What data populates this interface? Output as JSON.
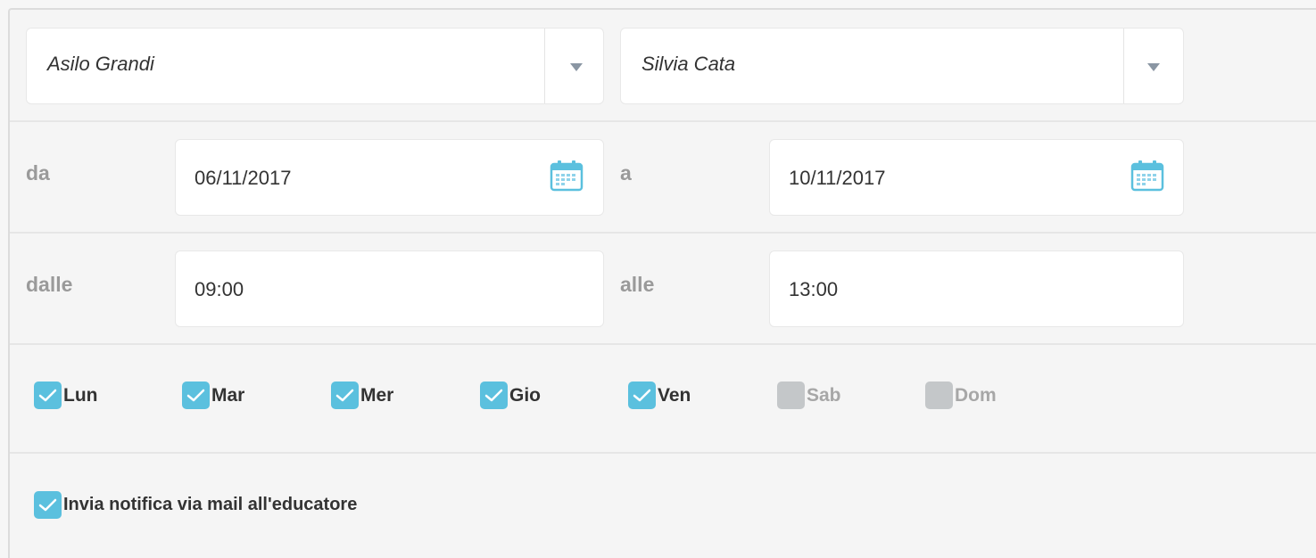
{
  "selects": {
    "school": {
      "value": "Asilo Grandi"
    },
    "educator": {
      "value": "Silvia Cata"
    }
  },
  "date_range": {
    "from_label": "da",
    "from_value": "06/11/2017",
    "to_label": "a",
    "to_value": "10/11/2017"
  },
  "time_range": {
    "from_label": "dalle",
    "from_value": "09:00",
    "to_label": "alle",
    "to_value": "13:00"
  },
  "days": [
    {
      "label": "Lun",
      "checked": true
    },
    {
      "label": "Mar",
      "checked": true
    },
    {
      "label": "Mer",
      "checked": true
    },
    {
      "label": "Gio",
      "checked": true
    },
    {
      "label": "Ven",
      "checked": true
    },
    {
      "label": "Sab",
      "checked": false
    },
    {
      "label": "Dom",
      "checked": false
    }
  ],
  "notify": {
    "label": "Invia notifica via mail all'educatore",
    "checked": true
  },
  "colors": {
    "accent": "#5bc0de",
    "unchecked": "#c4c7c9",
    "muted_label": "#9a9a9a"
  },
  "icons": {
    "dropdown": "caret-down-icon",
    "calendar": "calendar-icon",
    "check": "check-icon"
  }
}
